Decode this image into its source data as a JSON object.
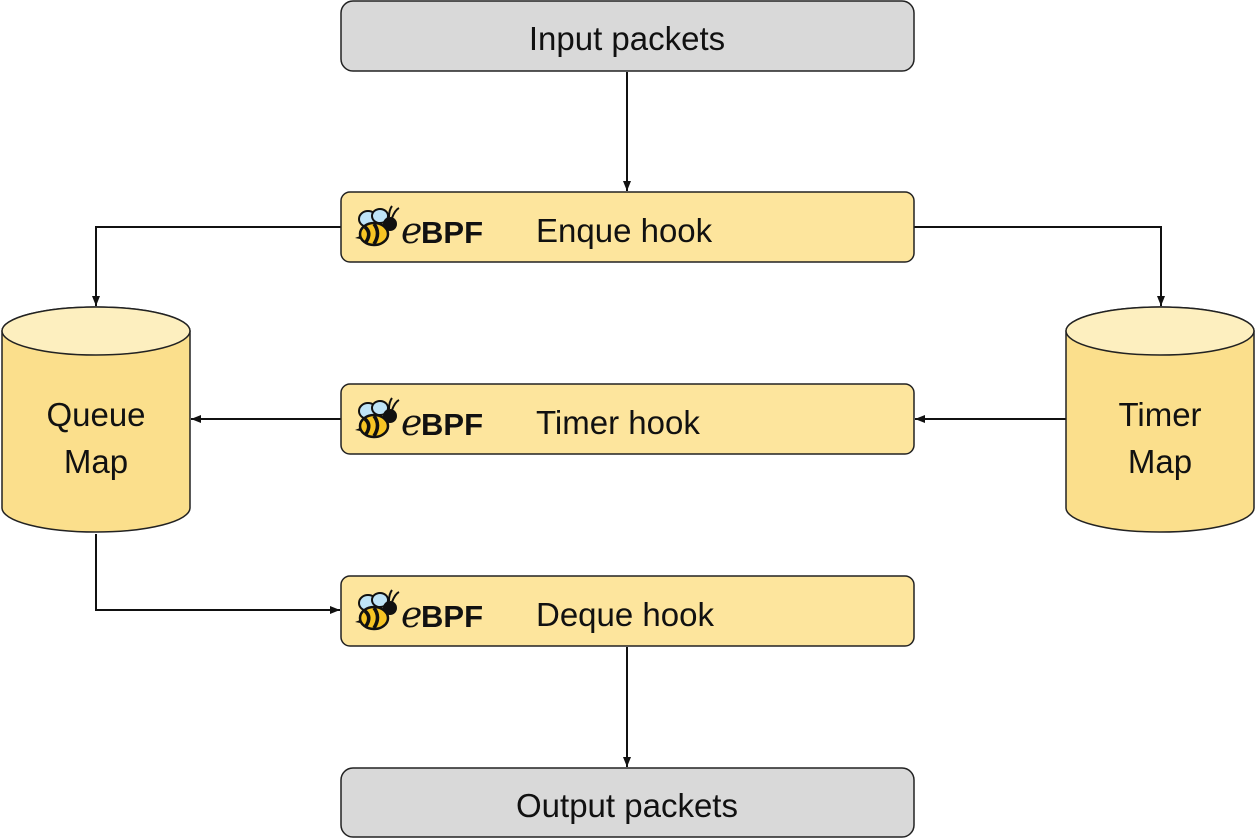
{
  "colors": {
    "io_fill": "#d9d9d9",
    "hook_fill": "#fde59d",
    "map_fill": "#fbdf8c",
    "map_top": "#fdefbf",
    "stroke": "#222222",
    "bee_yellow": "#f7c524",
    "bee_wing": "#bfe4f7"
  },
  "boxes": {
    "input": {
      "label": "Input packets"
    },
    "enqueue": {
      "label": "Enque hook"
    },
    "timer": {
      "label": "Timer hook"
    },
    "dequeue": {
      "label": "Deque hook"
    },
    "output": {
      "label": "Output packets"
    }
  },
  "ebpf_logo": {
    "prefix": "e",
    "suffix": "BPF",
    "icon": "ebpf-bee-icon"
  },
  "maps": {
    "queue": {
      "line1": "Queue",
      "line2": "Map"
    },
    "timer": {
      "line1": "Timer",
      "line2": "Map"
    }
  }
}
